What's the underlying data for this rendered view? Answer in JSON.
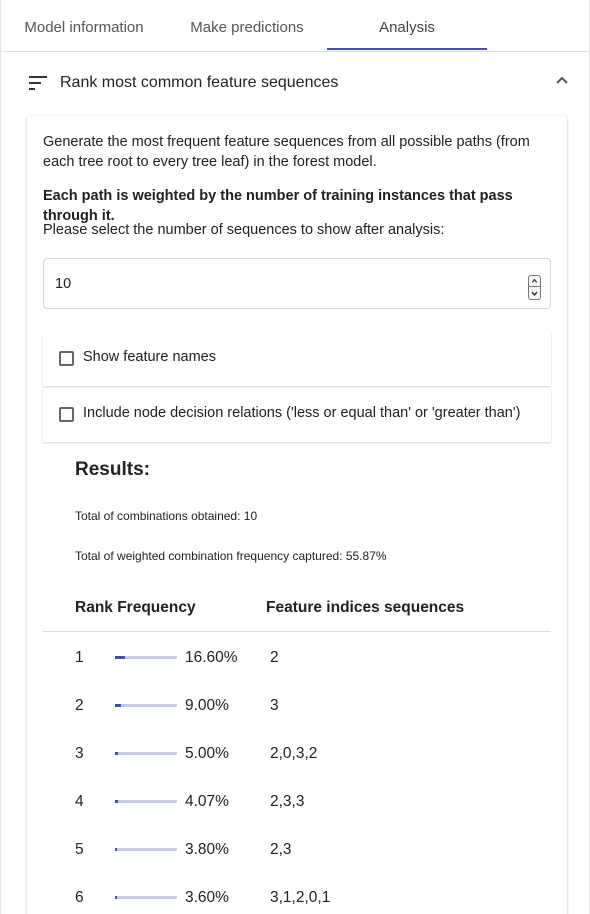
{
  "tabs": [
    {
      "label": "Model information"
    },
    {
      "label": "Make predictions"
    },
    {
      "label": "Analysis"
    }
  ],
  "panel": {
    "title": "Rank most common feature sequences",
    "description": "Generate the most frequent feature sequences from all possible paths (from each tree root to every tree leaf) in the forest model.",
    "weight_note": "Each path is weighted by the number of training instances that pass through it.",
    "select_prompt": "Please select the number of sequences to show after analysis:",
    "num_sequences": "10",
    "checkbox_feature_names": {
      "label": "Show feature names",
      "checked": false
    },
    "checkbox_relations": {
      "label": "Include node decision relations ('less or equal than' or 'greater than')",
      "checked": false
    }
  },
  "results": {
    "title": "Results:",
    "total_combinations": "Total of combinations obtained: 10",
    "total_weighted": "Total of weighted combination frequency captured: 55.87%",
    "col_rank_freq": "Rank Frequency",
    "col_sequences": "Feature indices sequences",
    "rows": [
      {
        "rank": "1",
        "frequency": "16.60%",
        "fraction": 0.166,
        "sequence": "2"
      },
      {
        "rank": "2",
        "frequency": "9.00%",
        "fraction": 0.09,
        "sequence": "3"
      },
      {
        "rank": "3",
        "frequency": "5.00%",
        "fraction": 0.05,
        "sequence": "2,0,3,2"
      },
      {
        "rank": "4",
        "frequency": "4.07%",
        "fraction": 0.0407,
        "sequence": "2,3,3"
      },
      {
        "rank": "5",
        "frequency": "3.80%",
        "fraction": 0.038,
        "sequence": "2,3"
      },
      {
        "rank": "6",
        "frequency": "3.60%",
        "fraction": 0.036,
        "sequence": "3,1,2,0,1"
      }
    ]
  },
  "colors": {
    "accent": "#3f51b5",
    "bar_track": "#c5cae9"
  },
  "icons": {
    "header": "sort-icon",
    "collapse": "chevron-up-icon"
  }
}
